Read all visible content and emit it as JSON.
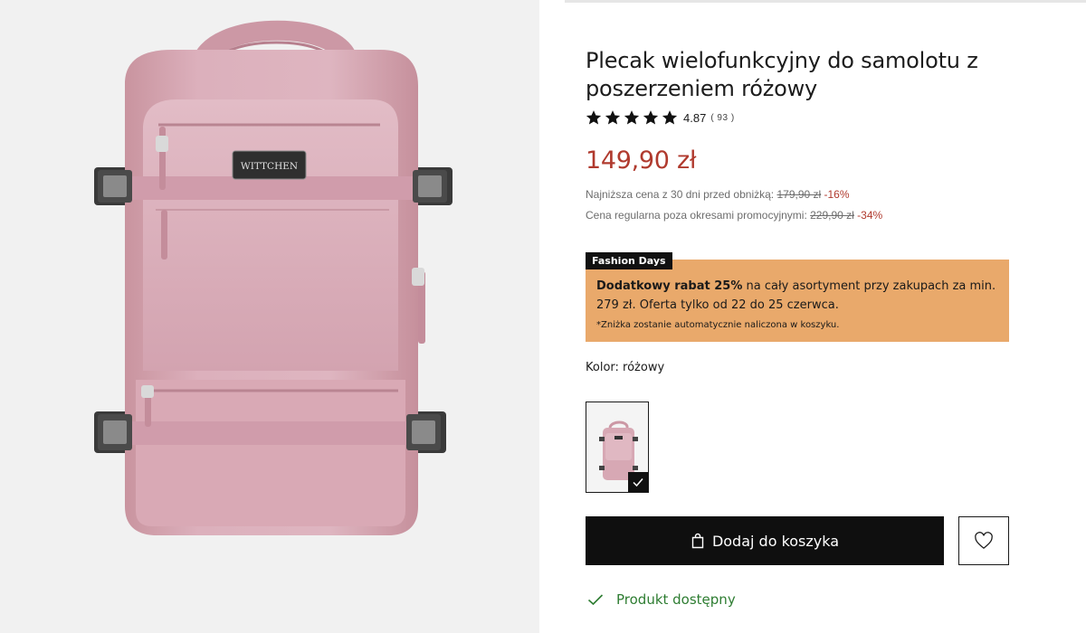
{
  "product": {
    "title": "Plecak wielofunkcyjny do samolotu z poszerzeniem różowy",
    "brand_logo": "WITTCHEN",
    "rating": {
      "stars": 5,
      "value": "4.87",
      "count": "( 93 )"
    },
    "price": "149,90 zł",
    "lowest_price": {
      "label": "Najniższa cena z 30 dni przed obniżką:",
      "old_price": "179,90 zł",
      "discount": "-16%"
    },
    "regular_price": {
      "label": "Cena regularna poza okresami promocyjnymi:",
      "old_price": "229,90 zł",
      "discount": "-34%"
    },
    "promo": {
      "tag": "Fashion Days",
      "bold": "Dodatkowy rabat 25%",
      "text": " na cały asortyment przy zakupach za min. 279 zł. Oferta tylko od 22 do 25 czerwca.",
      "fine_print": "*Zniżka zostanie automatycznie naliczona w koszyku."
    },
    "color_label": "Kolor: różowy",
    "add_to_cart": "Dodaj do koszyka",
    "availability": "Produkt dostępny"
  },
  "colors": {
    "price_red": "#b03a2e",
    "promo_orange": "#e9a96b",
    "available_green": "#2e7d32",
    "bag_pink": "#d8aab7"
  },
  "icons": [
    "star-icon",
    "bag-icon",
    "heart-icon",
    "check-icon"
  ]
}
